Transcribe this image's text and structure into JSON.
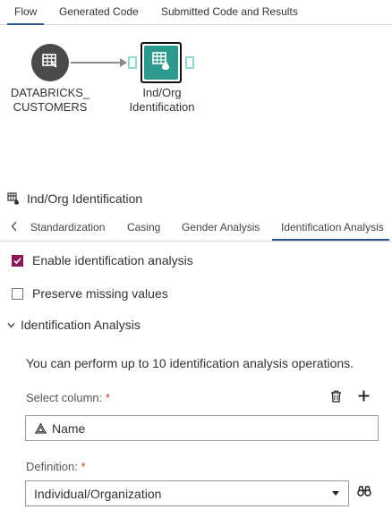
{
  "top_tabs": [
    {
      "label": "Flow",
      "active": true
    },
    {
      "label": "Generated Code",
      "active": false
    },
    {
      "label": "Submitted Code and Results",
      "active": false
    }
  ],
  "flow": {
    "source_node": {
      "label_line1": "DATABRICKS_",
      "label_line2": "CUSTOMERS",
      "icon": "table-icon"
    },
    "target_node": {
      "label_line1": "Ind/Org",
      "label_line2": "Identification",
      "icon": "identification-table-icon"
    }
  },
  "panel": {
    "title": "Ind/Org Identification",
    "title_icon": "identification-table-icon",
    "tabs": [
      {
        "label": "Standardization",
        "active": false
      },
      {
        "label": "Casing",
        "active": false
      },
      {
        "label": "Gender Analysis",
        "active": false
      },
      {
        "label": "Identification Analysis",
        "active": true
      }
    ],
    "enable_identification": {
      "label": "Enable identification analysis",
      "checked": true
    },
    "preserve_missing": {
      "label": "Preserve missing values",
      "checked": false
    },
    "section": {
      "label": "Identification Analysis",
      "expanded": true
    },
    "info": "You can perform up to 10 identification analysis operations.",
    "select_column": {
      "label": "Select column:",
      "required_mark": "*",
      "value": "Name",
      "value_icon": "character-column-icon"
    },
    "definition": {
      "label": "Definition:",
      "required_mark": "*",
      "value": "Individual/Organization"
    }
  },
  "colors": {
    "accent": "#2b5d8f",
    "node_teal": "#2e9a8e",
    "node_dark": "#4a4a4a",
    "checkbox": "#8b1a55",
    "required": "#c0392b"
  }
}
